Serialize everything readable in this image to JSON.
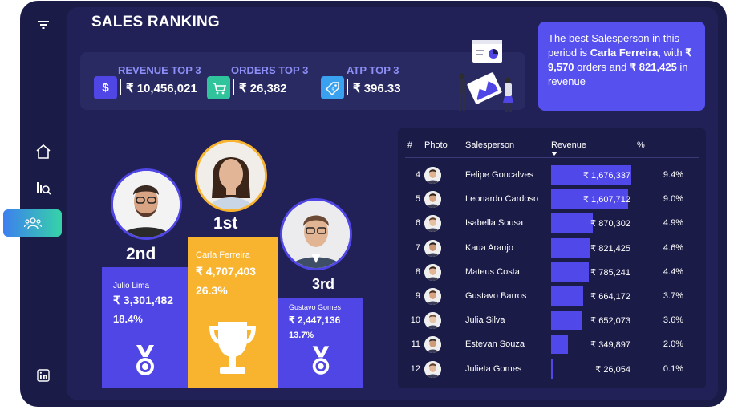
{
  "sidebar": {
    "items": [
      {
        "name": "filter-icon"
      },
      {
        "name": "home-icon"
      },
      {
        "name": "search-report-icon"
      },
      {
        "name": "team-icon",
        "active": true
      },
      {
        "name": "linkedin-icon"
      }
    ]
  },
  "header": {
    "title": "SALES RANKING"
  },
  "kpis": [
    {
      "label": "REVENUE TOP 3",
      "value": "₹ 10,456,021",
      "icon": "dollar-icon",
      "color": "#4f46e5"
    },
    {
      "label": "ORDERS TOP 3",
      "value": "₹ 26,382",
      "icon": "cart-icon",
      "color": "#2fc49b"
    },
    {
      "label": "ATP TOP 3",
      "value": "₹ 396.33",
      "icon": "price-tag-icon",
      "color": "#3aa1f0"
    }
  ],
  "insight": {
    "line1": "The best Salesperson in this period is ",
    "name": "Carla Ferreira",
    "line2": ", with ",
    "orders": "₹ 9,570",
    "line3": " orders and ",
    "revenue": "₹ 821,425",
    "line4": " in revenue"
  },
  "podium": {
    "first": {
      "rank": "1st",
      "name": "Carla Ferreira",
      "value": "₹ 4,707,403",
      "pct": "26.3%",
      "color": "#f8b32f"
    },
    "second": {
      "rank": "2nd",
      "name": "Julio Lima",
      "value": "₹ 3,301,482",
      "pct": "18.4%",
      "color": "#4f46e5"
    },
    "third": {
      "rank": "3rd",
      "name": "Gustavo Gomes",
      "value": "₹ 2,447,136",
      "pct": "13.7%",
      "color": "#4f46e5"
    }
  },
  "table": {
    "headers": {
      "rank": "#",
      "photo": "Photo",
      "salesperson": "Salesperson",
      "revenue": "Revenue",
      "pct": "%"
    },
    "max_revenue": 1676337,
    "rows": [
      {
        "rank": "4",
        "name": "Felipe Goncalves",
        "revenue": "₹ 1,676,337",
        "revenue_value": 1676337,
        "pct": "9.4%"
      },
      {
        "rank": "5",
        "name": "Leonardo Cardoso",
        "revenue": "₹ 1,607,712",
        "revenue_value": 1607712,
        "pct": "9.0%"
      },
      {
        "rank": "6",
        "name": "Isabella Sousa",
        "revenue": "₹ 870,302",
        "revenue_value": 870302,
        "pct": "4.9%"
      },
      {
        "rank": "7",
        "name": "Kaua Araujo",
        "revenue": "₹ 821,425",
        "revenue_value": 821425,
        "pct": "4.6%"
      },
      {
        "rank": "8",
        "name": "Mateus Costa",
        "revenue": "₹ 785,241",
        "revenue_value": 785241,
        "pct": "4.4%"
      },
      {
        "rank": "9",
        "name": "Gustavo Barros",
        "revenue": "₹ 664,172",
        "revenue_value": 664172,
        "pct": "3.7%"
      },
      {
        "rank": "10",
        "name": "Julia Silva",
        "revenue": "₹ 652,073",
        "revenue_value": 652073,
        "pct": "3.6%"
      },
      {
        "rank": "11",
        "name": "Estevan Souza",
        "revenue": "₹ 349,897",
        "revenue_value": 349897,
        "pct": "2.0%"
      },
      {
        "rank": "12",
        "name": "Julieta Gomes",
        "revenue": "₹ 26,054",
        "revenue_value": 26054,
        "pct": "0.1%"
      }
    ]
  },
  "colors": {
    "background": "#1b1b48",
    "panel": "#212158",
    "accent": "#4f46e5",
    "gold": "#f8b32f"
  }
}
